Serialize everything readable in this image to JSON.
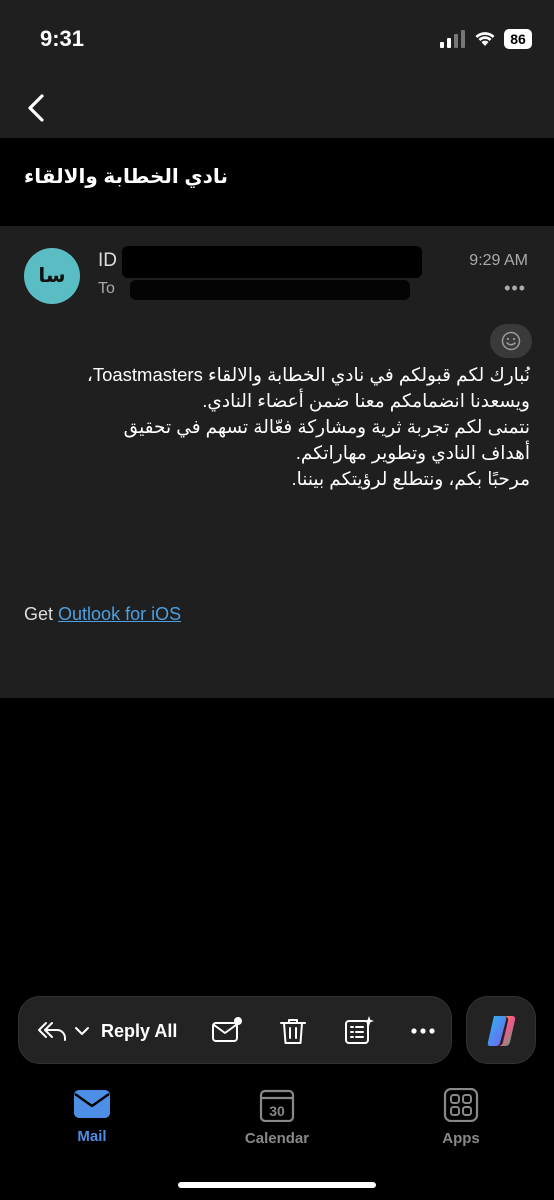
{
  "status_bar": {
    "time": "9:31",
    "battery": "86"
  },
  "subject": "نادي الخطابة والالقاء",
  "message": {
    "avatar_initials": "سا",
    "sender": "ID",
    "to_prefix": "To",
    "time": "9:29 AM",
    "more": "•••",
    "body": [
      "نُبارك لكم قبولكم في نادي الخطابة والالقاء Toastmasters،",
      "ويسعدنا انضمامكم معنا ضمن أعضاء النادي.",
      "نتمنى لكم تجربة ثرية ومشاركة فعّالة تسهم في تحقيق",
      "أهداف النادي وتطوير مهاراتكم.",
      "مرحبًا بكم، ونتطلع لرؤيتكم بيننا."
    ],
    "signature_prefix": "Get",
    "signature_link": "Outlook for iOS"
  },
  "toolbar": {
    "reply_all_label": "Reply All"
  },
  "tabs": [
    {
      "label": "Mail",
      "active": true
    },
    {
      "label": "Calendar",
      "icon_text": "30"
    },
    {
      "label": "Apps"
    }
  ],
  "colors": {
    "accent": "#4d8fe6",
    "avatar": "#5bbdc4",
    "link": "#4d9fe0"
  }
}
